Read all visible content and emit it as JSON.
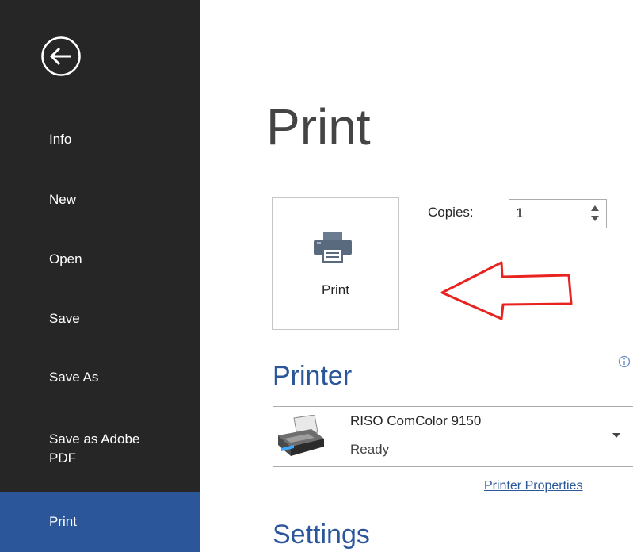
{
  "backstage": {
    "nav_items": [
      {
        "label": "Info"
      },
      {
        "label": "New"
      },
      {
        "label": "Open"
      },
      {
        "label": "Save"
      },
      {
        "label": "Save As"
      },
      {
        "label": "Save as Adobe PDF"
      },
      {
        "label": "Print"
      }
    ],
    "active_item": "Print",
    "sidebar_color": "#262626",
    "accent_color": "#2b579a"
  },
  "main": {
    "page_title": "Print",
    "print_button_label": "Print",
    "copies_label": "Copies:",
    "copies_value": "1",
    "printer_section_title": "Printer",
    "printer_name": "RISO ComColor 9150",
    "printer_status": "Ready",
    "printer_properties_link": "Printer Properties",
    "settings_section_title": "Settings",
    "annotation_arrow_color": "#e8231f"
  }
}
